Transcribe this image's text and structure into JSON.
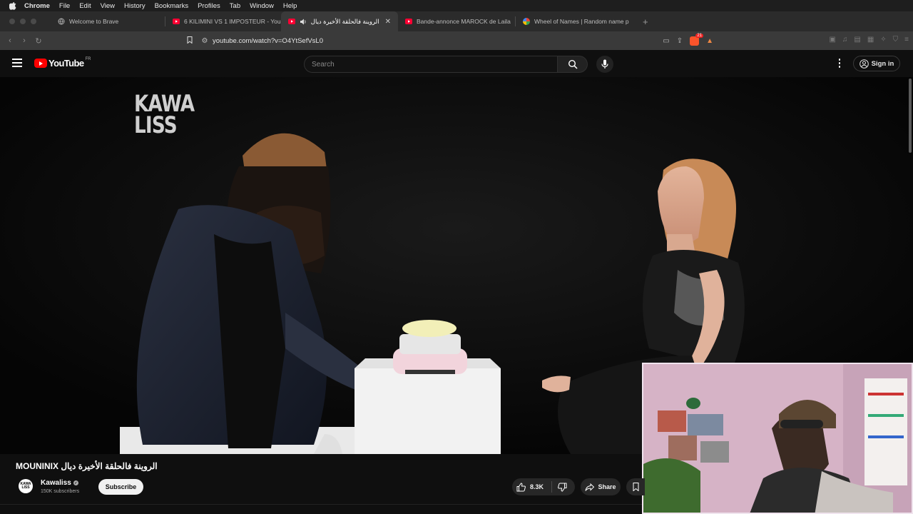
{
  "menubar": {
    "items": [
      "Chrome",
      "File",
      "Edit",
      "View",
      "History",
      "Bookmarks",
      "Profiles",
      "Tab",
      "Window",
      "Help"
    ]
  },
  "tabs": [
    {
      "title": "Welcome to Brave",
      "icon": "brave-globe-icon",
      "active": false
    },
    {
      "title": "6 KILIMINI VS 1 IMPOSTEUR - You",
      "icon": "youtube-icon",
      "active": false
    },
    {
      "title": "الروينة فالحلقة الأخيرة ديال ube",
      "icon": "youtube-icon",
      "active": true
    },
    {
      "title": "Bande-annonce MAROCK de Laila",
      "icon": "youtube-icon",
      "active": false
    },
    {
      "title": "Wheel of Names | Random name p",
      "icon": "wheel-icon",
      "active": false
    }
  ],
  "address": {
    "url": "youtube.com/watch?v=O4YtSefVsL0",
    "shields_badge": "21"
  },
  "youtube": {
    "logo_text": "YouTube",
    "region": "FR",
    "search_placeholder": "Search",
    "signin_label": "Sign in"
  },
  "video": {
    "watermark_line1": "KAWA",
    "watermark_line2": "LISS",
    "title": "الروينة فالحلقة الأخيرة ديال MOUNINIX",
    "channel": {
      "name": "Kawaliss",
      "subscribers": "150K subscribers",
      "avatar_text": "KAWA LISS"
    },
    "subscribe_label": "Subscribe",
    "likes": "8.3K",
    "share_label": "Share"
  },
  "colors": {
    "yt_red": "#ff0000",
    "bg": "#0f0f0f",
    "chip": "#272727"
  }
}
